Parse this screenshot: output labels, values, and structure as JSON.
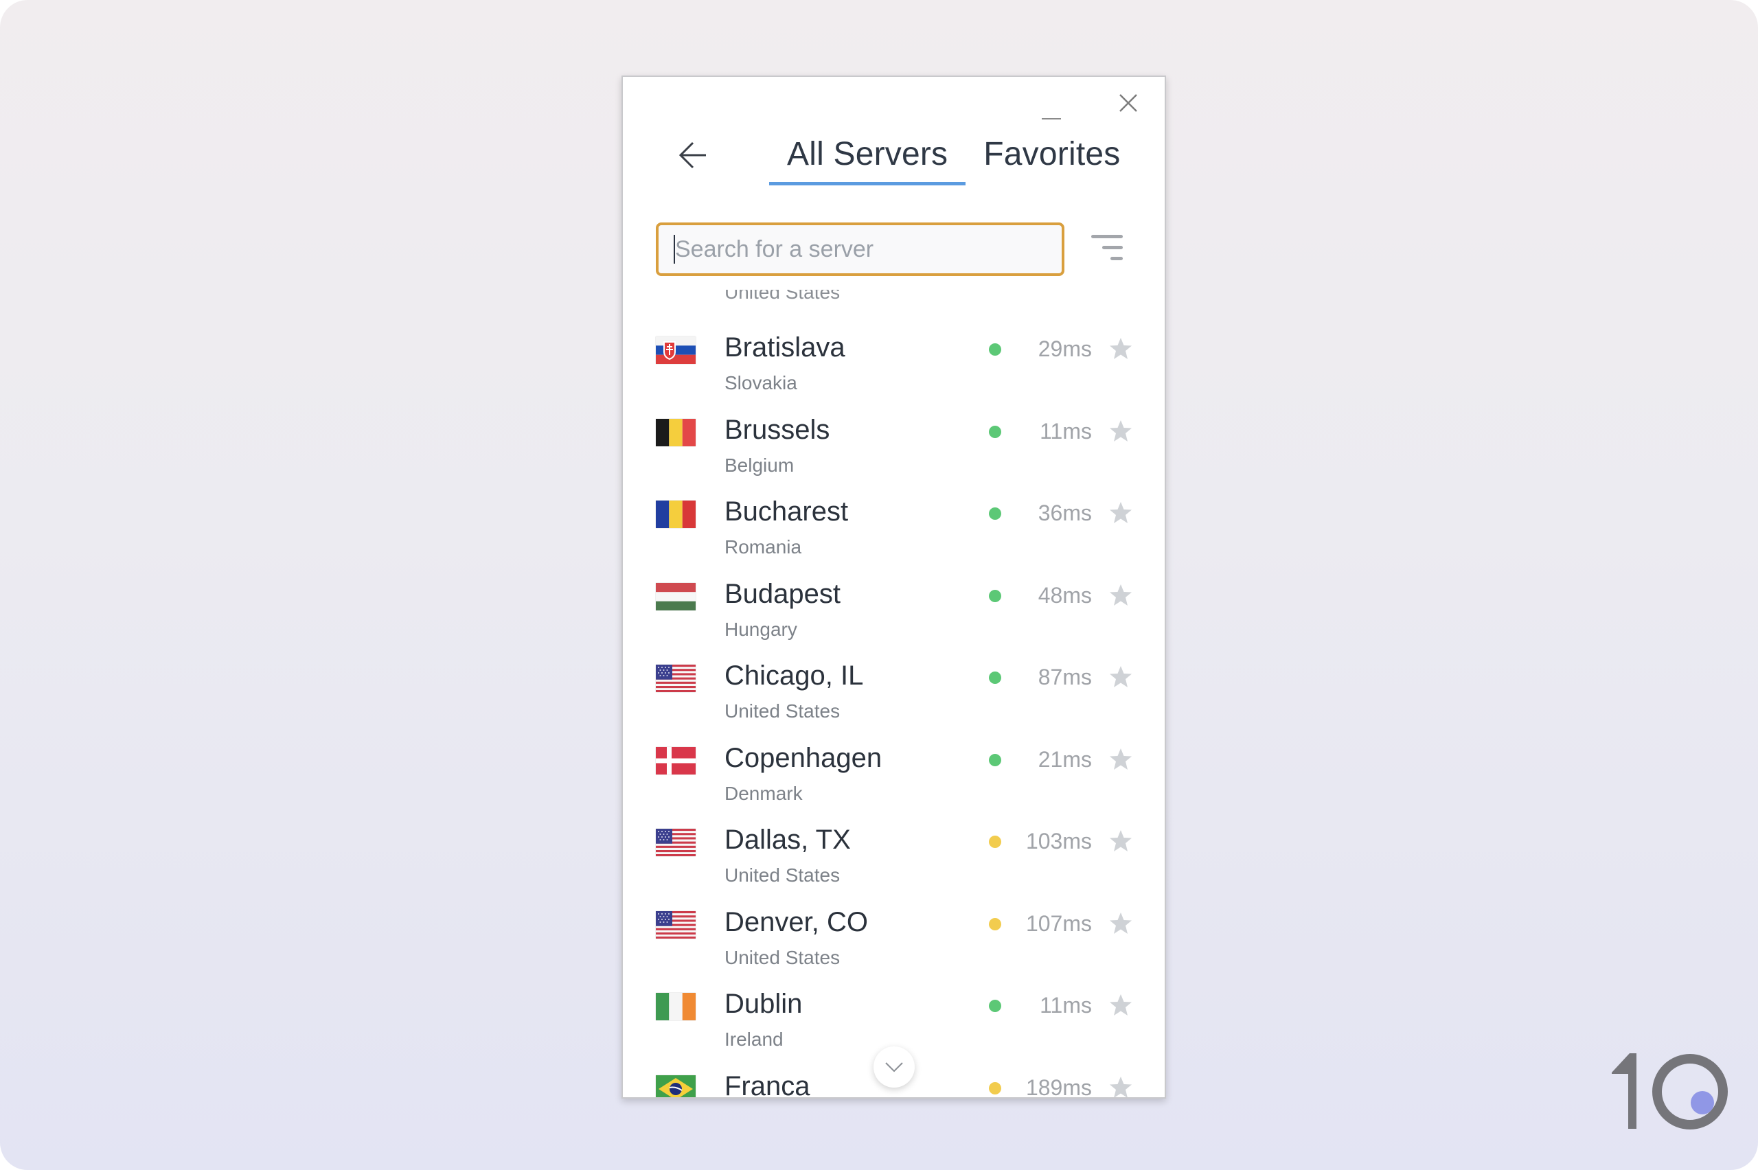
{
  "window": {
    "minimize_icon": "minimize-icon",
    "close_icon": "close-icon",
    "back_icon": "arrow-left-icon"
  },
  "tabs": [
    {
      "label": "All Servers",
      "active": true
    },
    {
      "label": "Favorites",
      "active": false
    }
  ],
  "search": {
    "value": "",
    "placeholder": "Search for a server"
  },
  "filter_icon": "filter-icon",
  "colors": {
    "accent_tab": "#5b9be0",
    "search_border": "#d99f3e",
    "status_good": "#5cc876",
    "status_medium": "#f2cc4e",
    "star_inactive": "#cfd2d6"
  },
  "partial_top_country": "United States",
  "servers": [
    {
      "city": "Bratislava",
      "country": "Slovakia",
      "flag": "sk",
      "status": "good",
      "ping": "29ms",
      "favorite": false
    },
    {
      "city": "Brussels",
      "country": "Belgium",
      "flag": "be",
      "status": "good",
      "ping": "11ms",
      "favorite": false
    },
    {
      "city": "Bucharest",
      "country": "Romania",
      "flag": "ro",
      "status": "good",
      "ping": "36ms",
      "favorite": false
    },
    {
      "city": "Budapest",
      "country": "Hungary",
      "flag": "hu",
      "status": "good",
      "ping": "48ms",
      "favorite": false
    },
    {
      "city": "Chicago, IL",
      "country": "United States",
      "flag": "us",
      "status": "good",
      "ping": "87ms",
      "favorite": false
    },
    {
      "city": "Copenhagen",
      "country": "Denmark",
      "flag": "dk",
      "status": "good",
      "ping": "21ms",
      "favorite": false
    },
    {
      "city": "Dallas, TX",
      "country": "United States",
      "flag": "us",
      "status": "medium",
      "ping": "103ms",
      "favorite": false
    },
    {
      "city": "Denver, CO",
      "country": "United States",
      "flag": "us",
      "status": "medium",
      "ping": "107ms",
      "favorite": false
    },
    {
      "city": "Dublin",
      "country": "Ireland",
      "flag": "ie",
      "status": "good",
      "ping": "11ms",
      "favorite": false
    },
    {
      "city": "Franca",
      "country": "",
      "flag": "br",
      "status": "medium",
      "ping": "189ms",
      "favorite": false
    }
  ],
  "scroll_down_icon": "chevron-down-icon",
  "watermark": {
    "text": "10",
    "icon": "brand-logo"
  }
}
